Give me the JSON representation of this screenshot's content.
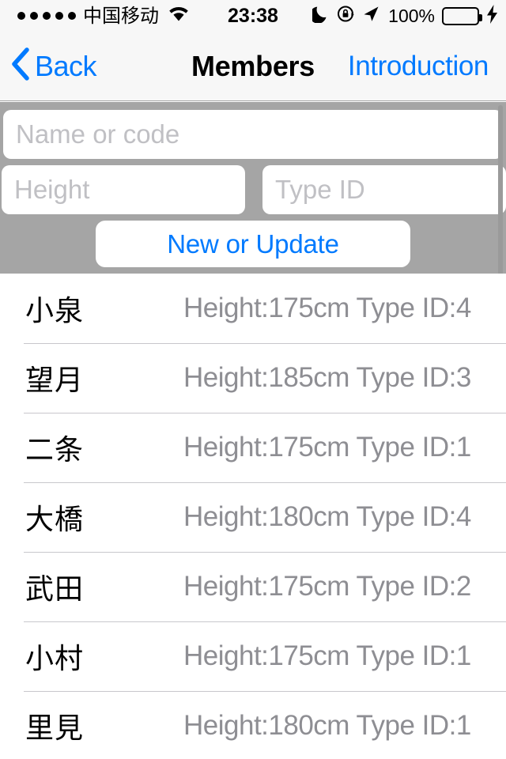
{
  "status_bar": {
    "signal_dots": 5,
    "carrier": "中国移动",
    "wifi_icon": "wifi-icon",
    "time": "23:38",
    "dnd_icon": "moon-icon",
    "rotation_lock_icon": "rotation-lock-icon",
    "location_icon": "location-arrow-icon",
    "battery_percent": "100%",
    "battery_level": 100,
    "battery_color": "#4cd964",
    "charging_icon": "lightning-bolt-icon"
  },
  "nav_bar": {
    "back_icon": "chevron-left-icon",
    "back_label": "Back",
    "title": "Members",
    "right_label": "Introduction",
    "tint_color": "#007aff"
  },
  "form": {
    "background_color": "#a5a5a5",
    "name_placeholder": "Name or code",
    "name_value": "",
    "height_placeholder": "Height",
    "height_value": "",
    "type_id_placeholder": "Type ID",
    "type_id_value": "",
    "submit_label": "New or Update"
  },
  "list": {
    "rows": [
      {
        "name": "小泉",
        "detail": "Height:175cm Type ID:4"
      },
      {
        "name": "望月",
        "detail": "Height:185cm Type ID:3"
      },
      {
        "name": "二条",
        "detail": "Height:175cm Type ID:1"
      },
      {
        "name": "大橋",
        "detail": "Height:180cm Type ID:4"
      },
      {
        "name": "武田",
        "detail": "Height:175cm Type ID:2"
      },
      {
        "name": "小村",
        "detail": "Height:175cm Type ID:1"
      },
      {
        "name": "里見",
        "detail": "Height:180cm Type ID:1"
      }
    ]
  }
}
